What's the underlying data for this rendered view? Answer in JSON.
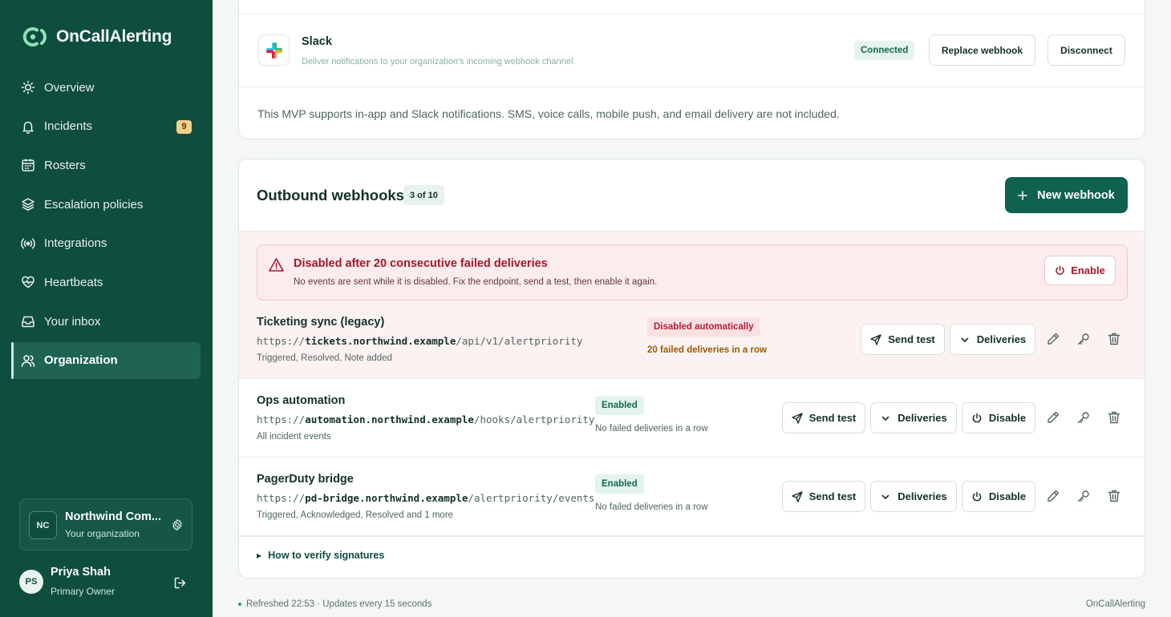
{
  "app": {
    "name": "OnCallAlerting"
  },
  "sidebar": {
    "items": [
      {
        "label": "Overview",
        "icon": "sun-icon"
      },
      {
        "label": "Incidents",
        "icon": "bell-icon",
        "badge": "9"
      },
      {
        "label": "Rosters",
        "icon": "calendar-icon"
      },
      {
        "label": "Escalation policies",
        "icon": "layers-icon"
      },
      {
        "label": "Integrations",
        "icon": "broadcast-icon"
      },
      {
        "label": "Heartbeats",
        "icon": "heart-pulse-icon"
      },
      {
        "label": "Your inbox",
        "icon": "inbox-icon"
      },
      {
        "label": "Organization",
        "icon": "users-icon",
        "active": true
      }
    ],
    "org": {
      "initials": "NC",
      "name": "Northwind Com...",
      "subtitle": "Your organization"
    },
    "user": {
      "initials": "PS",
      "name": "Priya Shah",
      "role": "Primary Owner"
    }
  },
  "slack": {
    "title": "Slack",
    "description": "Deliver notifications to your organization's incoming webhook channel.",
    "status": "Connected",
    "replace_label": "Replace webhook",
    "disconnect_label": "Disconnect",
    "note": "This MVP supports in-app and Slack notifications. SMS, voice calls, mobile push, and email delivery are not included."
  },
  "webhooks": {
    "title": "Outbound webhooks",
    "count": "3 of 10",
    "new_label": "New webhook",
    "alert": {
      "title": "Disabled after 20 consecutive failed deliveries",
      "description": "No events are sent while it is disabled. Fix the endpoint, send a test, then enable it again.",
      "enable_label": "Enable"
    },
    "rows": [
      {
        "name": "Ticketing sync (legacy)",
        "url_scheme": "https://",
        "url_host": "tickets.northwind.example",
        "url_path": "/api/v1/alertpriority",
        "events": "Triggered, Resolved, Note added",
        "status": "Disabled automatically",
        "failures": "20 failed deliveries in a row",
        "send_test": "Send test",
        "deliveries": "Deliveries"
      },
      {
        "name": "Ops automation",
        "url_scheme": "https://",
        "url_host": "automation.northwind.example",
        "url_path": "/hooks/alertpriority",
        "events": "All incident events",
        "status": "Enabled",
        "failures": "No failed deliveries in a row",
        "send_test": "Send test",
        "deliveries": "Deliveries",
        "disable": "Disable"
      },
      {
        "name": "PagerDuty bridge",
        "url_scheme": "https://",
        "url_host": "pd-bridge.northwind.example",
        "url_path": "/alertpriority/events",
        "events": "Triggered, Acknowledged, Resolved and 1 more",
        "status": "Enabled",
        "failures": "No failed deliveries in a row",
        "send_test": "Send test",
        "deliveries": "Deliveries",
        "disable": "Disable"
      }
    ],
    "verify_label": "How to verify signatures"
  },
  "footer": {
    "refresh": "Refreshed 22:53 · Updates every 15 seconds",
    "brand": "OnCallAlerting"
  },
  "colors": {
    "sidebar": "#0f4d3f",
    "primary": "#0f6150",
    "danger": "#a3182b",
    "warning": "#9a5a00"
  }
}
